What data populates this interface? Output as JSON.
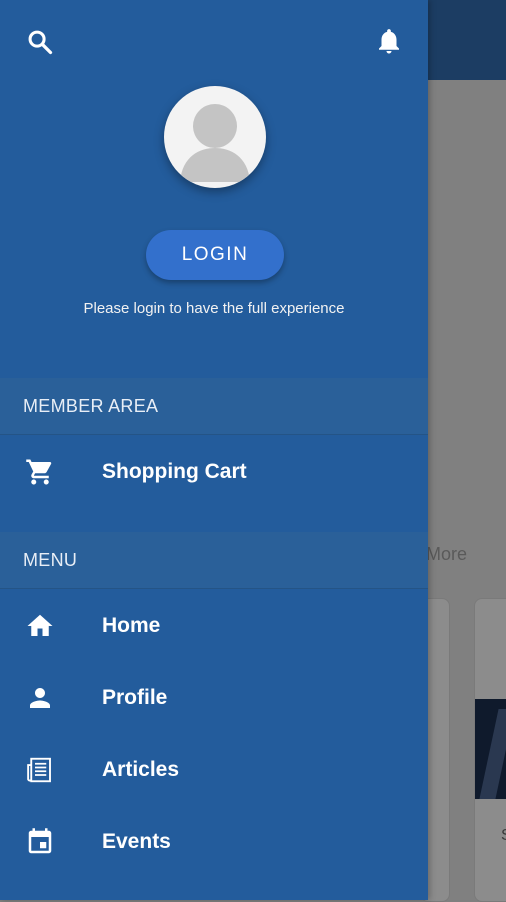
{
  "background": {
    "view_more_partial": "v More",
    "card_text_partial": "S"
  },
  "drawer": {
    "icons": {
      "search": "search-icon",
      "notifications": "bell-icon"
    },
    "avatar": "avatar-placeholder-icon",
    "login_label": "LOGIN",
    "login_hint": "Please login to have the full experience",
    "member_area": {
      "title": "MEMBER AREA",
      "items": [
        {
          "label": "Shopping Cart",
          "icon": "cart-icon"
        }
      ]
    },
    "menu": {
      "title": "MENU",
      "items": [
        {
          "label": "Home",
          "icon": "home-icon"
        },
        {
          "label": "Profile",
          "icon": "person-icon"
        },
        {
          "label": "Articles",
          "icon": "newspaper-icon"
        },
        {
          "label": "Events",
          "icon": "calendar-icon"
        }
      ]
    }
  },
  "colors": {
    "drawer_bg": "#235c9c",
    "login_button": "#3370cc",
    "topbar": "#1c3d63"
  }
}
